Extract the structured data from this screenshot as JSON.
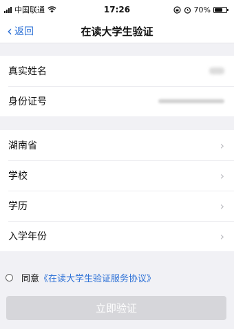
{
  "status_bar": {
    "carrier": "中国联通",
    "time": "17:26",
    "battery": "70%",
    "battery_level": 0.7
  },
  "nav": {
    "back_label": "返回",
    "title": "在读大学生验证"
  },
  "identity": {
    "name_label": "真实姓名",
    "id_label": "身份证号"
  },
  "school_info": {
    "items": [
      {
        "label": "湖南省"
      },
      {
        "label": "学校"
      },
      {
        "label": "学历"
      },
      {
        "label": "入学年份"
      }
    ]
  },
  "agreement": {
    "prefix": "同意",
    "link": "《在读大学生验证服务协议》"
  },
  "submit_label": "立即验证",
  "colors": {
    "accent": "#2a6fd6",
    "disabled_button": "#d6d6da",
    "background": "#f1f1f5"
  }
}
